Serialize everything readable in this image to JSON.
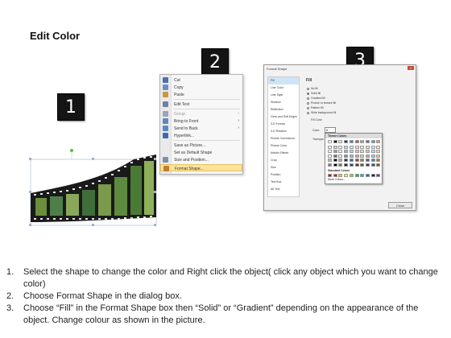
{
  "title": "Edit Color",
  "badges": {
    "one": "1",
    "two": "2",
    "three": "3"
  },
  "context_menu": {
    "items": [
      {
        "label": "Cut",
        "icon": "scissors-icon",
        "color": "#4a6fb3"
      },
      {
        "label": "Copy",
        "icon": "copy-icon",
        "color": "#6b8fc7"
      },
      {
        "label": "Paste",
        "icon": "paste-icon",
        "color": "#c79a3d"
      },
      {
        "label": "Edit Text",
        "icon": "edit-text-icon",
        "color": "#6f7fa0"
      },
      {
        "label": "Group",
        "icon": "group-icon",
        "color": "#9aa5b8",
        "submenu": true
      },
      {
        "label": "Bring to Front",
        "icon": "bring-front-icon",
        "color": "#5e86c2",
        "submenu": true
      },
      {
        "label": "Send to Back",
        "icon": "send-back-icon",
        "color": "#5e86c2",
        "submenu": true
      },
      {
        "label": "Hyperlink...",
        "icon": "hyperlink-icon",
        "color": "#3e6bb5"
      },
      {
        "label": "Save as Picture...",
        "icon": "",
        "color": ""
      },
      {
        "label": "Set as Default Shape",
        "icon": "",
        "color": ""
      },
      {
        "label": "Size and Position...",
        "icon": "size-position-icon",
        "color": "#7a8fb0"
      },
      {
        "label": "Format Shape...",
        "icon": "format-shape-icon",
        "color": "#c47b2e",
        "highlighted": true
      }
    ]
  },
  "format_dialog": {
    "title": "Format Shape",
    "nav": [
      "Fill",
      "Line Color",
      "Line Style",
      "Shadow",
      "Reflection",
      "Glow and Soft Edges",
      "3-D Format",
      "3-D Rotation",
      "Picture Corrections",
      "Picture Color",
      "Artistic Effects",
      "Crop",
      "Size",
      "Position",
      "Text Box",
      "Alt Text"
    ],
    "fill_heading": "Fill",
    "options": [
      {
        "label": "No fill",
        "selected": false
      },
      {
        "label": "Solid fill",
        "selected": true
      },
      {
        "label": "Gradient fill",
        "selected": false
      },
      {
        "label": "Picture or texture fill",
        "selected": false
      },
      {
        "label": "Pattern fill",
        "selected": false
      },
      {
        "label": "Slide background fill",
        "selected": false
      }
    ],
    "fill_color_label": "Fill Color",
    "color_label": "Color:",
    "transparency_label": "Transpar",
    "close_label": "Close",
    "picker": {
      "theme_label": "Theme Colors",
      "standard_label": "Standard Colors",
      "more_label": "More Colors...",
      "theme_top": [
        "#ffffff",
        "#000000",
        "#e9e5d6",
        "#1f3a5f",
        "#4f81bd",
        "#c0504d",
        "#9bbb59",
        "#8064a2",
        "#4bacc6",
        "#f79646"
      ],
      "standard": [
        "#c00000",
        "#ff0000",
        "#ffc000",
        "#ffff00",
        "#92d050",
        "#00b050",
        "#00b0f0",
        "#0070c0",
        "#002060",
        "#7030a0"
      ]
    }
  },
  "steps": [
    {
      "num": "1.",
      "text": "Select the shape to change the color and Right click the object( click any object which you want to change color)"
    },
    {
      "num": "2.",
      "text": "Choose Format Shape in the dialog box."
    },
    {
      "num": "3.",
      "text": "Choose “Fill” in the Format Shape box then “Solid” or “Gradient” depending on the appearance of the object. Change colour as shown in the picture."
    }
  ]
}
